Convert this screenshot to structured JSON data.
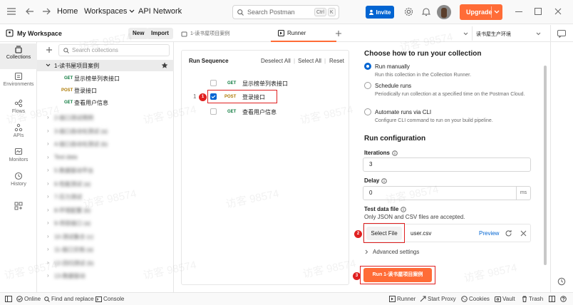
{
  "topbar": {
    "nav_items": [
      "Home",
      "Workspaces",
      "API Network"
    ],
    "search_placeholder": "Search Postman",
    "search_shortcut": [
      "Ctrl",
      "K"
    ],
    "invite_label": "Invite",
    "upgrade_label": "Upgrade"
  },
  "workspace": {
    "title": "My Workspace",
    "new_label": "New",
    "import_label": "Import"
  },
  "rail": {
    "items": [
      "Collections",
      "Environments",
      "Flows",
      "APIs",
      "Monitors",
      "History"
    ]
  },
  "sidebar": {
    "search_placeholder": "Search collections",
    "collection_name": "1-读书屋项目案例",
    "requests": [
      {
        "method": "GET",
        "name": "显示榜单列表接口"
      },
      {
        "method": "POST",
        "name": "登录接口"
      },
      {
        "method": "GET",
        "name": "查看用户信息"
      }
    ],
    "blurred_collections": [
      "2-接口测试用例",
      "3-接口自动化测试 (a)",
      "4-接口自动化测试 (b)",
      "Test data",
      "5-数据驱动平台",
      "6-性能测试 (a)",
      "7-压力测试",
      "8-环境配置 (b)",
      "9-项目接口 (a)",
      "10-测试集合 (c)",
      "11-接口文档 (a)",
      "12-回归测试 (b)",
      "13-数据驱动"
    ]
  },
  "tabs": {
    "tab1": "1-读书屋项目案例",
    "tab2": "Runner",
    "environment": "读书屋生产环境"
  },
  "runner": {
    "header": "Run Sequence",
    "deselect_all": "Deselect All",
    "select_all": "Select All",
    "reset": "Reset",
    "rows": [
      {
        "method": "GET",
        "name": "显示榜单列表接口",
        "checked": false,
        "index": ""
      },
      {
        "method": "POST",
        "name": "登录接口",
        "checked": true,
        "index": "1"
      },
      {
        "method": "GET",
        "name": "查看用户信息",
        "checked": false,
        "index": ""
      }
    ],
    "step_badges": [
      "1",
      "2",
      "3"
    ]
  },
  "config": {
    "heading": "Choose how to run your collection",
    "options": [
      {
        "title": "Run manually",
        "desc": "Run this collection in the Collection Runner.",
        "selected": true
      },
      {
        "title": "Schedule runs",
        "desc": "Periodically run collection at a specified time on the Postman Cloud.",
        "selected": false
      },
      {
        "title": "Automate runs via CLI",
        "desc": "Configure CLI command to run on your build pipeline.",
        "selected": false
      }
    ],
    "run_config_heading": "Run configuration",
    "iterations_label": "Iterations",
    "iterations_value": "3",
    "delay_label": "Delay",
    "delay_value": "0",
    "delay_unit": "ms",
    "test_data_label": "Test data file",
    "test_data_hint": "Only JSON and CSV files are accepted.",
    "select_file_label": "Select File",
    "file_name": "user.csv",
    "preview_label": "Preview",
    "advanced_label": "Advanced settings",
    "run_button": "Run 1-读书屋项目案例"
  },
  "statusbar": {
    "online": "Online",
    "find_replace": "Find and replace",
    "console": "Console",
    "runner": "Runner",
    "start_proxy": "Start Proxy",
    "cookies": "Cookies",
    "vault": "Vault",
    "trash": "Trash"
  },
  "watermark": "访客 98574",
  "colors": {
    "accent": "#ff6c37",
    "primary": "#0265d2",
    "get": "#0f7b3f",
    "post": "#ad7a03",
    "highlight": "#e02020"
  }
}
